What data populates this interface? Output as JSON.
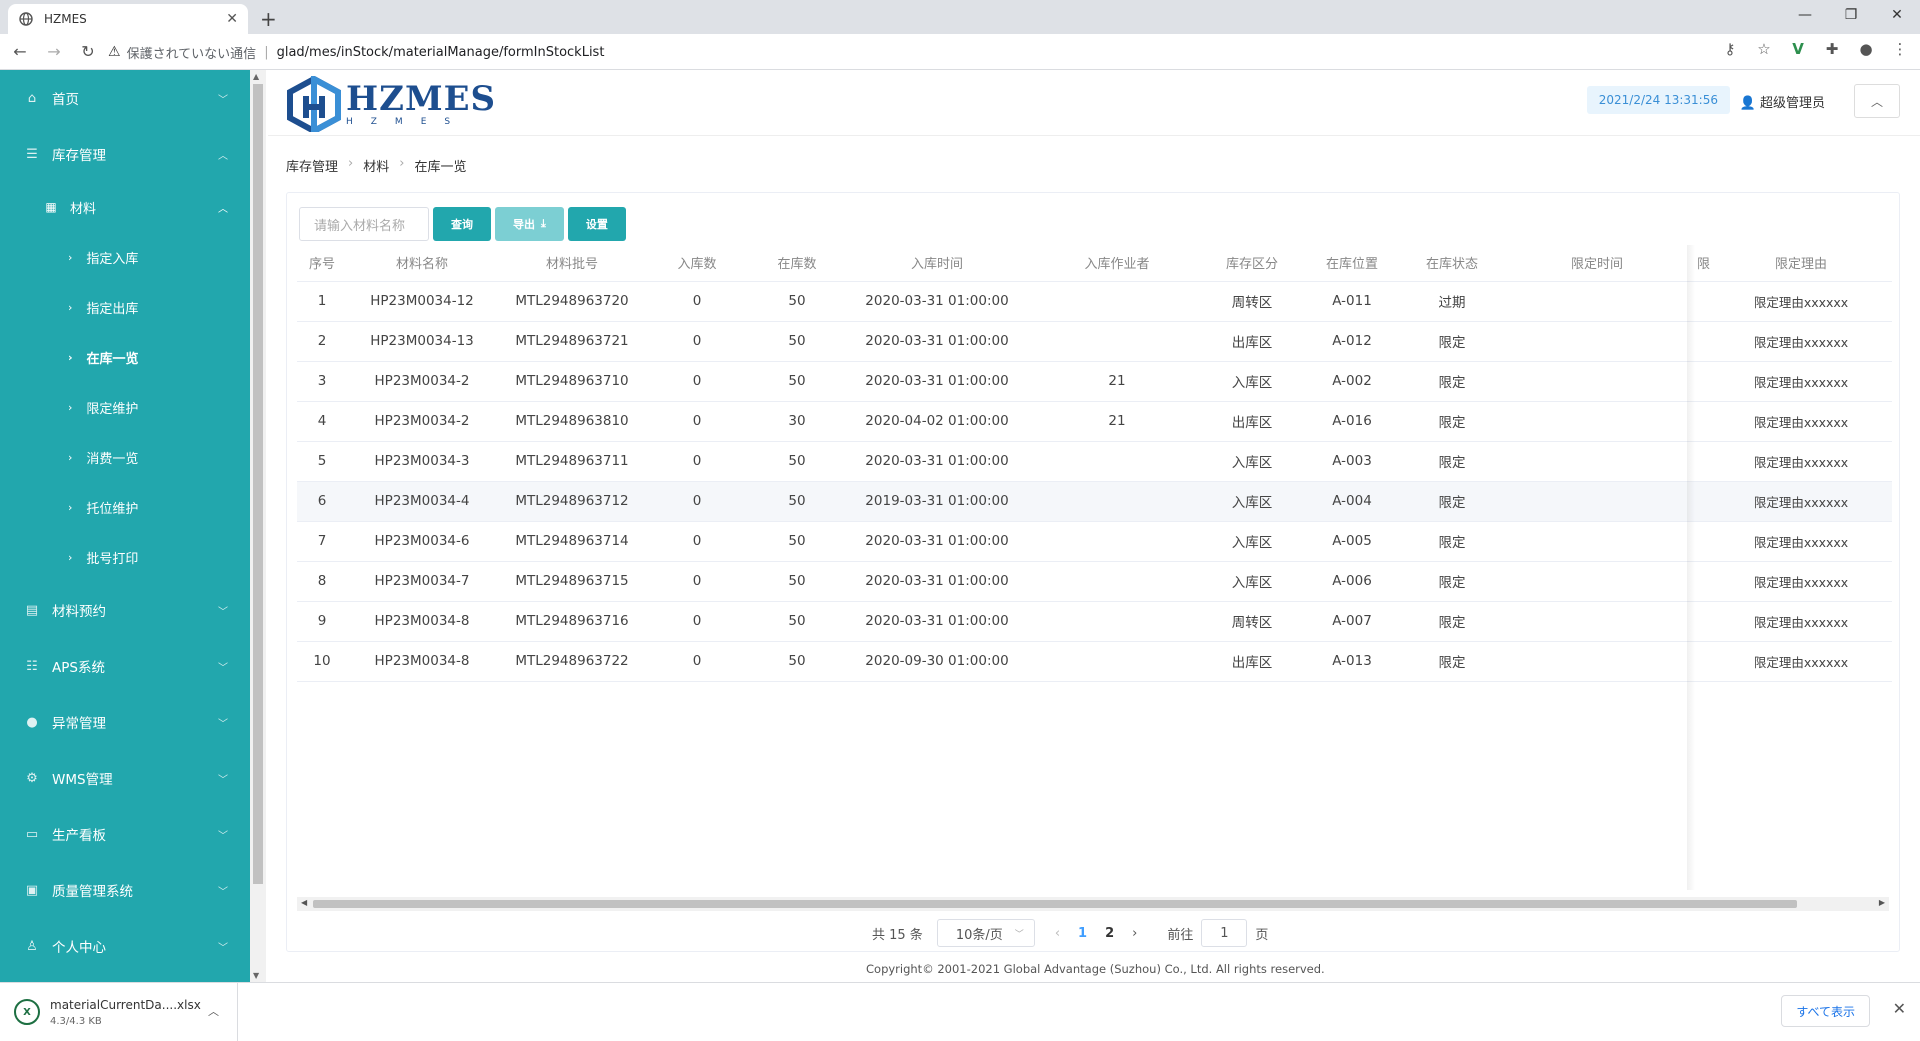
{
  "browser": {
    "tab_title": "HZMES",
    "security_text": "保護されていない通信",
    "url": "glad/mes/inStock/materialManage/formInStockList"
  },
  "sidebar": {
    "items": [
      {
        "label": "首页",
        "icon": "home-icon"
      },
      {
        "label": "库存管理",
        "icon": "database-icon"
      },
      {
        "label": "材料预约",
        "icon": "clipboard-icon"
      },
      {
        "label": "APS系统",
        "icon": "sliders-icon"
      },
      {
        "label": "异常管理",
        "icon": "alert-icon"
      },
      {
        "label": "WMS管理",
        "icon": "gear-icon"
      },
      {
        "label": "生产看板",
        "icon": "monitor-icon"
      },
      {
        "label": "质量管理系统",
        "icon": "chart-icon"
      },
      {
        "label": "个人中心",
        "icon": "user-icon"
      }
    ],
    "sub": {
      "label": "材料",
      "icon": "grid-icon"
    },
    "leaves": [
      "指定入库",
      "指定出库",
      "在库一览",
      "限定维护",
      "消费一览",
      "托位维护",
      "批号打印"
    ]
  },
  "header": {
    "logo_text": "HZMES",
    "logo_sub": "HZMES",
    "datetime": "2021/2/24 13:31:56",
    "user": "超级管理员"
  },
  "breadcrumb": [
    "库存管理",
    "材料",
    "在库一览"
  ],
  "toolbar": {
    "search_placeholder": "请输入材料名称",
    "query": "查询",
    "export": "导出",
    "settings": "设置"
  },
  "table": {
    "headers": [
      "序号",
      "材料名称",
      "材料批号",
      "入库数",
      "在库数",
      "入库时间",
      "入库作业者",
      "库存区分",
      "在库位置",
      "在库状态",
      "限定时间",
      "限",
      "限定理由"
    ],
    "rows": [
      [
        "1",
        "HP23M0034-12",
        "MTL2948963720",
        "0",
        "50",
        "2020-03-31 01:00:00",
        "",
        "周转区",
        "A-011",
        "过期",
        "",
        "",
        "限定理由xxxxxx"
      ],
      [
        "2",
        "HP23M0034-13",
        "MTL2948963721",
        "0",
        "50",
        "2020-03-31 01:00:00",
        "",
        "出库区",
        "A-012",
        "限定",
        "",
        "",
        "限定理由xxxxxx"
      ],
      [
        "3",
        "HP23M0034-2",
        "MTL2948963710",
        "0",
        "50",
        "2020-03-31 01:00:00",
        "21",
        "入库区",
        "A-002",
        "限定",
        "",
        "",
        "限定理由xxxxxx"
      ],
      [
        "4",
        "HP23M0034-2",
        "MTL2948963810",
        "0",
        "30",
        "2020-04-02 01:00:00",
        "21",
        "出库区",
        "A-016",
        "限定",
        "",
        "",
        "限定理由xxxxxx"
      ],
      [
        "5",
        "HP23M0034-3",
        "MTL2948963711",
        "0",
        "50",
        "2020-03-31 01:00:00",
        "",
        "入库区",
        "A-003",
        "限定",
        "",
        "",
        "限定理由xxxxxx"
      ],
      [
        "6",
        "HP23M0034-4",
        "MTL2948963712",
        "0",
        "50",
        "2019-03-31 01:00:00",
        "",
        "入库区",
        "A-004",
        "限定",
        "",
        "",
        "限定理由xxxxxx"
      ],
      [
        "7",
        "HP23M0034-6",
        "MTL2948963714",
        "0",
        "50",
        "2020-03-31 01:00:00",
        "",
        "入库区",
        "A-005",
        "限定",
        "",
        "",
        "限定理由xxxxxx"
      ],
      [
        "8",
        "HP23M0034-7",
        "MTL2948963715",
        "0",
        "50",
        "2020-03-31 01:00:00",
        "",
        "入库区",
        "A-006",
        "限定",
        "",
        "",
        "限定理由xxxxxx"
      ],
      [
        "9",
        "HP23M0034-8",
        "MTL2948963716",
        "0",
        "50",
        "2020-03-31 01:00:00",
        "",
        "周转区",
        "A-007",
        "限定",
        "",
        "",
        "限定理由xxxxxx"
      ],
      [
        "10",
        "HP23M0034-8",
        "MTL2948963722",
        "0",
        "50",
        "2020-09-30 01:00:00",
        "",
        "出库区",
        "A-013",
        "限定",
        "",
        "",
        "限定理由xxxxxx"
      ]
    ]
  },
  "pager": {
    "total": "共 15 条",
    "page_size": "10条/页",
    "pages": [
      "1",
      "2"
    ],
    "goto_label": "前往",
    "goto_value": "1",
    "page_suffix": "页"
  },
  "footer": {
    "copyright": "Copyright© 2001-2021 Global Advantage (Suzhou) Co., Ltd. All rights reserved."
  },
  "download": {
    "filename": "materialCurrentDa....xlsx",
    "size": "4.3/4.3 KB",
    "show_all": "すべて表示"
  },
  "colors": {
    "sidebar": "#22a7ad",
    "primary_button": "#22a7ad",
    "logo": "#1d4e8f",
    "active_page": "#409eff"
  }
}
